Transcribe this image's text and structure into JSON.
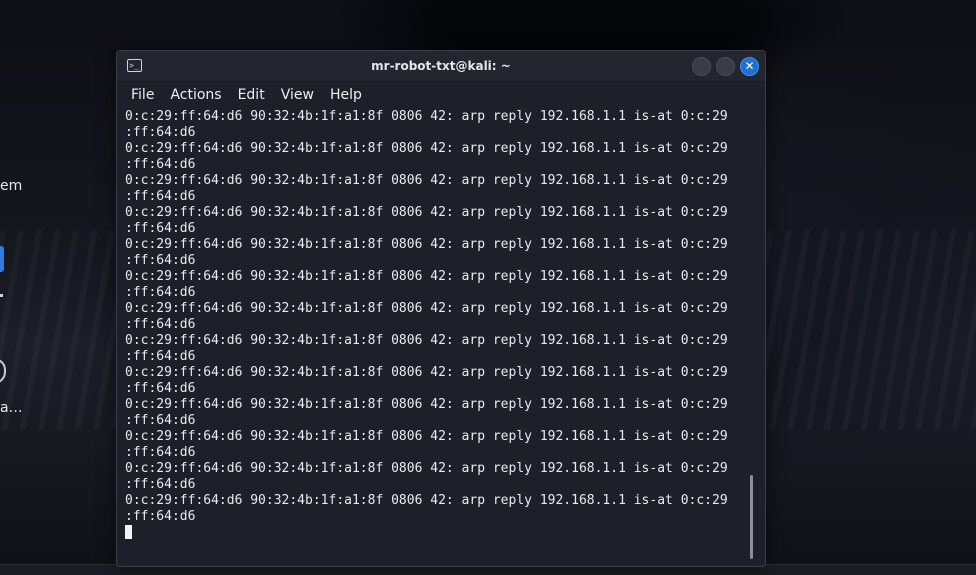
{
  "desktop": {
    "fragments": [
      "em",
      "a…"
    ]
  },
  "window": {
    "title": "mr-robot-txt@kali: ~",
    "app_icon_glyph": ">_",
    "close_glyph": "✕"
  },
  "menu": [
    "File",
    "Actions",
    "Edit",
    "View",
    "Help"
  ],
  "terminal": {
    "lines": [
      "0:c:29:ff:64:d6 90:32:4b:1f:a1:8f 0806 42: arp reply 192.168.1.1 is-at 0:c:29",
      ":ff:64:d6",
      "0:c:29:ff:64:d6 90:32:4b:1f:a1:8f 0806 42: arp reply 192.168.1.1 is-at 0:c:29",
      ":ff:64:d6",
      "0:c:29:ff:64:d6 90:32:4b:1f:a1:8f 0806 42: arp reply 192.168.1.1 is-at 0:c:29",
      ":ff:64:d6",
      "0:c:29:ff:64:d6 90:32:4b:1f:a1:8f 0806 42: arp reply 192.168.1.1 is-at 0:c:29",
      ":ff:64:d6",
      "0:c:29:ff:64:d6 90:32:4b:1f:a1:8f 0806 42: arp reply 192.168.1.1 is-at 0:c:29",
      ":ff:64:d6",
      "0:c:29:ff:64:d6 90:32:4b:1f:a1:8f 0806 42: arp reply 192.168.1.1 is-at 0:c:29",
      ":ff:64:d6",
      "0:c:29:ff:64:d6 90:32:4b:1f:a1:8f 0806 42: arp reply 192.168.1.1 is-at 0:c:29",
      ":ff:64:d6",
      "0:c:29:ff:64:d6 90:32:4b:1f:a1:8f 0806 42: arp reply 192.168.1.1 is-at 0:c:29",
      ":ff:64:d6",
      "0:c:29:ff:64:d6 90:32:4b:1f:a1:8f 0806 42: arp reply 192.168.1.1 is-at 0:c:29",
      ":ff:64:d6",
      "0:c:29:ff:64:d6 90:32:4b:1f:a1:8f 0806 42: arp reply 192.168.1.1 is-at 0:c:29",
      ":ff:64:d6",
      "0:c:29:ff:64:d6 90:32:4b:1f:a1:8f 0806 42: arp reply 192.168.1.1 is-at 0:c:29",
      ":ff:64:d6",
      "0:c:29:ff:64:d6 90:32:4b:1f:a1:8f 0806 42: arp reply 192.168.1.1 is-at 0:c:29",
      ":ff:64:d6",
      "0:c:29:ff:64:d6 90:32:4b:1f:a1:8f 0806 42: arp reply 192.168.1.1 is-at 0:c:29",
      ":ff:64:d6"
    ]
  },
  "colors": {
    "accent": "#1f6fd8",
    "terminal_bg": "#1d2029",
    "text": "#e8eaef"
  }
}
